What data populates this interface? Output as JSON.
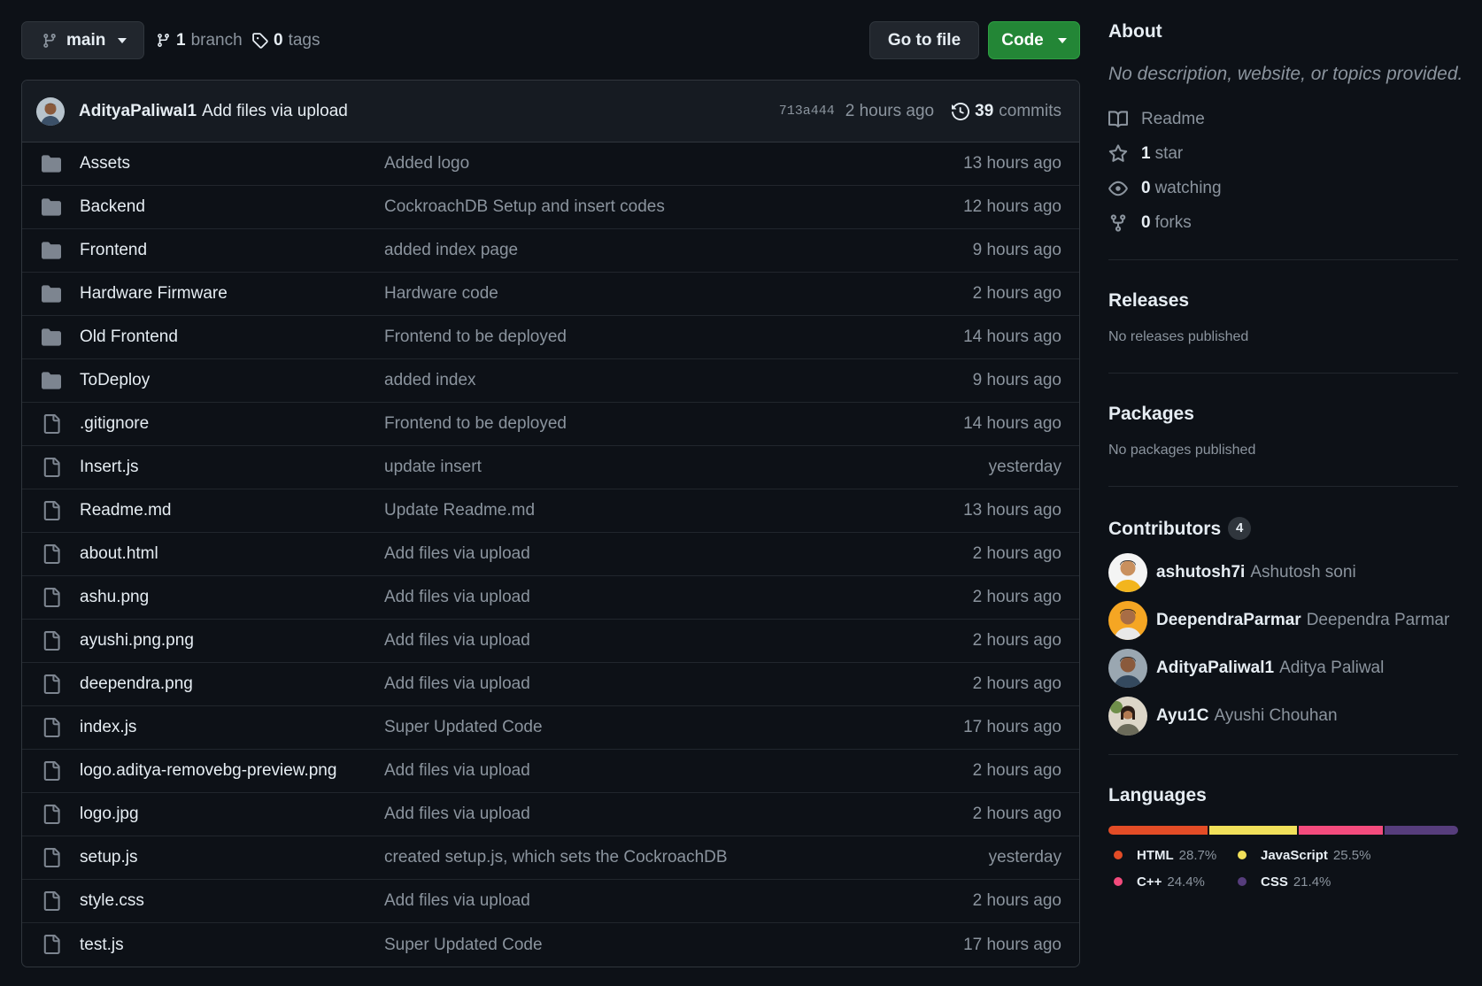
{
  "toolbar": {
    "branch_label": "main",
    "branches_count": "1",
    "branches_label": "branch",
    "tags_count": "0",
    "tags_label": "tags",
    "goto_file_label": "Go to file",
    "code_label": "Code"
  },
  "latest_commit": {
    "author": "AdityaPaliwal1",
    "message": "Add files via upload",
    "sha": "713a444",
    "time": "2 hours ago",
    "commits_count": "39",
    "commits_label": "commits"
  },
  "files": [
    {
      "type": "dir",
      "name": "Assets",
      "message": "Added logo",
      "time": "13 hours ago"
    },
    {
      "type": "dir",
      "name": "Backend",
      "message": "CockroachDB Setup and insert codes",
      "time": "12 hours ago"
    },
    {
      "type": "dir",
      "name": "Frontend",
      "message": "added index page",
      "time": "9 hours ago"
    },
    {
      "type": "dir",
      "name": "Hardware Firmware",
      "message": "Hardware code",
      "time": "2 hours ago"
    },
    {
      "type": "dir",
      "name": "Old Frontend",
      "message": "Frontend to be deployed",
      "time": "14 hours ago"
    },
    {
      "type": "dir",
      "name": "ToDeploy",
      "message": "added index",
      "time": "9 hours ago"
    },
    {
      "type": "file",
      "name": ".gitignore",
      "message": "Frontend to be deployed",
      "time": "14 hours ago"
    },
    {
      "type": "file",
      "name": "Insert.js",
      "message": "update insert",
      "time": "yesterday"
    },
    {
      "type": "file",
      "name": "Readme.md",
      "message": "Update Readme.md",
      "time": "13 hours ago"
    },
    {
      "type": "file",
      "name": "about.html",
      "message": "Add files via upload",
      "time": "2 hours ago"
    },
    {
      "type": "file",
      "name": "ashu.png",
      "message": "Add files via upload",
      "time": "2 hours ago"
    },
    {
      "type": "file",
      "name": "ayushi.png.png",
      "message": "Add files via upload",
      "time": "2 hours ago"
    },
    {
      "type": "file",
      "name": "deependra.png",
      "message": "Add files via upload",
      "time": "2 hours ago"
    },
    {
      "type": "file",
      "name": "index.js",
      "message": "Super Updated Code",
      "time": "17 hours ago"
    },
    {
      "type": "file",
      "name": "logo.aditya-removebg-preview.png",
      "message": "Add files via upload",
      "time": "2 hours ago"
    },
    {
      "type": "file",
      "name": "logo.jpg",
      "message": "Add files via upload",
      "time": "2 hours ago"
    },
    {
      "type": "file",
      "name": "setup.js",
      "message": "created setup.js, which sets the CockroachDB",
      "time": "yesterday"
    },
    {
      "type": "file",
      "name": "style.css",
      "message": "Add files via upload",
      "time": "2 hours ago"
    },
    {
      "type": "file",
      "name": "test.js",
      "message": "Super Updated Code",
      "time": "17 hours ago"
    }
  ],
  "about": {
    "heading": "About",
    "description": "No description, website, or topics provided.",
    "readme_label": "Readme",
    "stars_count": "1",
    "stars_label": "star",
    "watching_count": "0",
    "watching_label": "watching",
    "forks_count": "0",
    "forks_label": "forks"
  },
  "releases": {
    "heading": "Releases",
    "text": "No releases published"
  },
  "packages": {
    "heading": "Packages",
    "text": "No packages published"
  },
  "contributors": {
    "heading": "Contributors",
    "count": "4",
    "items": [
      {
        "login": "ashutosh7i",
        "name": "Ashutosh soni"
      },
      {
        "login": "DeependraParmar",
        "name": "Deependra Parmar"
      },
      {
        "login": "AdityaPaliwal1",
        "name": "Aditya Paliwal"
      },
      {
        "login": "Ayu1C",
        "name": "Ayushi Chouhan"
      }
    ]
  },
  "languages": {
    "heading": "Languages",
    "items": [
      {
        "name": "HTML",
        "percent": "28.7%",
        "value": 28.7,
        "color": "#e34c26"
      },
      {
        "name": "JavaScript",
        "percent": "25.5%",
        "value": 25.5,
        "color": "#f1e05a"
      },
      {
        "name": "C++",
        "percent": "24.4%",
        "value": 24.4,
        "color": "#f34b7d"
      },
      {
        "name": "CSS",
        "percent": "21.4%",
        "value": 21.4,
        "color": "#563d7c"
      }
    ]
  }
}
